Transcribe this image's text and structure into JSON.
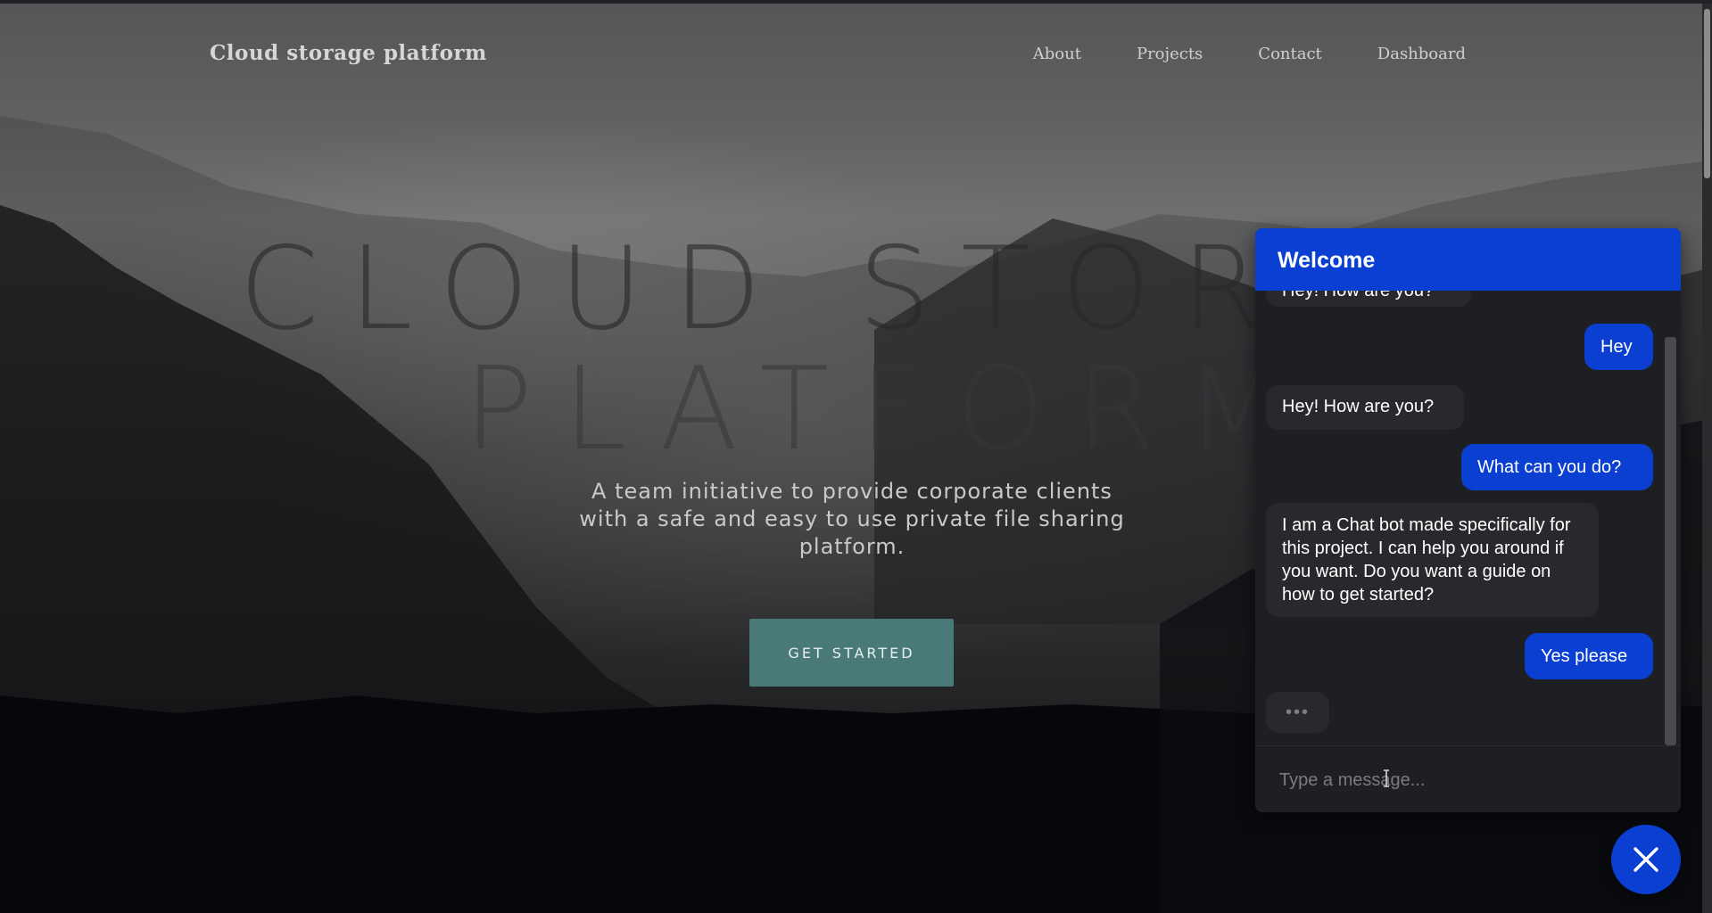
{
  "brand": "Cloud storage platform",
  "nav": {
    "items": [
      "About",
      "Projects",
      "Contact",
      "Dashboard"
    ]
  },
  "hero": {
    "title_line1": "CLOUD STORA",
    "title_line2": "PLATFORM",
    "subtitle": "A team initiative to provide corporate clients with a safe and easy to use private file sharing platform.",
    "cta_label": "GET STARTED"
  },
  "chat": {
    "title": "Welcome",
    "messages": [
      {
        "from": "bot",
        "text": "Hey! How are you?"
      },
      {
        "from": "user",
        "text": "Hey"
      },
      {
        "from": "bot",
        "text": "Hey! How are you?"
      },
      {
        "from": "user",
        "text": "What can you do?"
      },
      {
        "from": "bot",
        "text": "I am a Chat bot made specifically for this project. I can help you around if you want. Do you want a guide on how to get started?"
      },
      {
        "from": "user",
        "text": "Yes please"
      }
    ],
    "typing_indicator": "•••",
    "input_placeholder": "Type a message...",
    "colors": {
      "accent": "#0a3fd1",
      "panel": "#1e1f22",
      "bot_bubble": "#28292c"
    }
  },
  "icons": {
    "close": "close-icon",
    "text_cursor": "text-cursor-icon"
  },
  "colors": {
    "cta": "#4a7a78"
  }
}
